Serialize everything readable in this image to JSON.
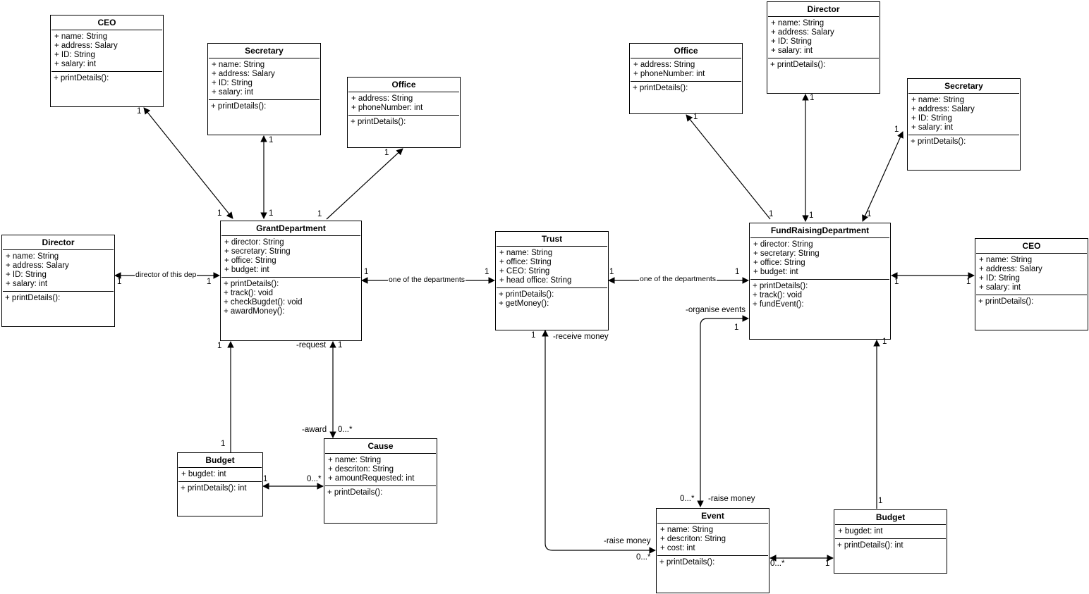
{
  "classes": {
    "ceo_left": {
      "title": "CEO",
      "attrs": [
        "+ name: String",
        "+ address: Salary",
        "+ ID: String",
        "+ salary: int"
      ],
      "ops": [
        "+ printDetails():"
      ]
    },
    "secretary_left": {
      "title": "Secretary",
      "attrs": [
        "+ name: String",
        "+ address: Salary",
        "+ ID: String",
        "+ salary: int"
      ],
      "ops": [
        "+ printDetails():"
      ]
    },
    "office_left": {
      "title": "Office",
      "attrs": [
        "+ address: String",
        "+ phoneNumber: int"
      ],
      "ops": [
        "+ printDetails():"
      ]
    },
    "director_left": {
      "title": "Director",
      "attrs": [
        "+ name: String",
        "+ address: Salary",
        "+ ID: String",
        "+ salary: int"
      ],
      "ops": [
        "+ printDetails():"
      ]
    },
    "grant_department": {
      "title": "GrantDepartment",
      "attrs": [
        "+ director: String",
        "+ secretary: String",
        "+ office: String",
        "+ budget: int"
      ],
      "ops": [
        "+ printDetails():",
        "+ track(): void",
        "+ checkBugdet(): void",
        "+ awardMoney():"
      ]
    },
    "budget_left": {
      "title": "Budget",
      "attrs": [
        "+ bugdet: int"
      ],
      "ops": [
        "+ printDetails(): int"
      ]
    },
    "cause": {
      "title": "Cause",
      "attrs": [
        "+ name: String",
        "+ descriton: String",
        "+ amountRequested: int"
      ],
      "ops": [
        "+ printDetails():"
      ]
    },
    "trust": {
      "title": "Trust",
      "attrs": [
        "+ name: String",
        "+ office: String",
        "+ CEO: String",
        "+ head office: String"
      ],
      "ops": [
        "+ printDetails():",
        "+ getMoney():"
      ]
    },
    "office_right": {
      "title": "Office",
      "attrs": [
        "+ address: String",
        "+ phoneNumber: int"
      ],
      "ops": [
        "+ printDetails():"
      ]
    },
    "director_right": {
      "title": "Director",
      "attrs": [
        "+ name: String",
        "+ address: Salary",
        "+ ID: String",
        "+ salary: int"
      ],
      "ops": [
        "+ printDetails():"
      ]
    },
    "secretary_right": {
      "title": "Secretary",
      "attrs": [
        "+ name: String",
        "+ address: Salary",
        "+ ID: String",
        "+ salary: int"
      ],
      "ops": [
        "+ printDetails():"
      ]
    },
    "fundraising_department": {
      "title": "FundRaisingDepartment",
      "attrs": [
        "+ director: String",
        "+ secretary: String",
        "+ office: String",
        "+ budget: int"
      ],
      "ops": [
        "+ printDetails():",
        "+ track(): void",
        "+ fundEvent():"
      ]
    },
    "ceo_right": {
      "title": "CEO",
      "attrs": [
        "+ name: String",
        "+ address: Salary",
        "+ ID: String",
        "+ salary: int"
      ],
      "ops": [
        "+ printDetails():"
      ]
    },
    "event": {
      "title": "Event",
      "attrs": [
        "+ name: String",
        "+ descriton: String",
        "+ cost: int"
      ],
      "ops": [
        "+ printDetails():"
      ]
    },
    "budget_right": {
      "title": "Budget",
      "attrs": [
        "+ bugdet: int"
      ],
      "ops": [
        "+ printDetails(): int"
      ]
    }
  },
  "labels": {
    "director_of_this_dep": "director of this dep",
    "one_of_departments_left": "one of the departments",
    "one_of_departments_right": "one of the departments",
    "request": "-request",
    "award": "-award",
    "receive_money": "-receive money",
    "organise_events": "-organise events",
    "raise_money_top": "-raise money",
    "raise_money_left": "-raise money"
  },
  "multiplicities": {
    "one": "1",
    "many": "0...*"
  }
}
